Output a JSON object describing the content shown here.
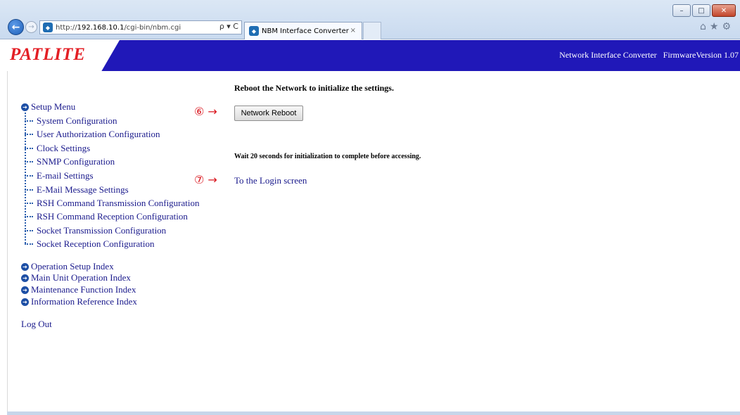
{
  "browser": {
    "address_prefix": "http://",
    "address_host": "192.168.10.1",
    "address_path": "/cgi-bin/nbm.cgi",
    "address_tools": "ρ ▾ C",
    "tab_title": "NBM Interface Converter",
    "tab_close": "×",
    "window_min": "–",
    "window_max": "□",
    "window_close": "✕"
  },
  "header": {
    "logo": "PATLITE",
    "info": "Network Interface Converter   FirmwareVersion 1.07",
    "colors": {
      "bar": "#2018b8",
      "logo": "#e31e24"
    }
  },
  "sidebar": {
    "setup_menu": "Setup Menu",
    "setup_items": [
      "System Configuration",
      "User Authorization Configuration",
      "Clock Settings",
      "SNMP Configuration",
      "E-mail Settings",
      "E-Mail Message Settings",
      "RSH Command Transmission Configuration",
      "RSH Command Reception Configuration",
      "Socket Transmission Configuration",
      "Socket Reception Configuration"
    ],
    "indexes": [
      "Operation Setup Index",
      "Main Unit Operation Index",
      "Maintenance Function Index",
      "Information Reference Index"
    ],
    "logout": "Log Out"
  },
  "main": {
    "heading": "Reboot the Network to initialize the settings.",
    "annotation_6": "⑥ →",
    "reboot_button": "Network Reboot",
    "wait_text": "Wait 20 seconds for initialization to complete before accessing.",
    "annotation_7": "⑦ →",
    "login_link": "To the Login screen"
  }
}
